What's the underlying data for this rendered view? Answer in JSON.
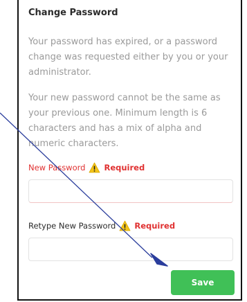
{
  "change_password": {
    "title": "Change Password",
    "paragraph_expired": "Your password has expired, or a password change was requested either by you or your administrator.",
    "paragraph_rules": "Your new password cannot be the same as your previous one. Minimum length is 6 characters and has a mix of alpha and numeric characters.",
    "new_password": {
      "label": "New Password",
      "required_text": "Required",
      "value": "",
      "placeholder": ""
    },
    "retype_password": {
      "label": "Retype New Password",
      "required_text": "Required",
      "value": "",
      "placeholder": ""
    },
    "save_label": "Save"
  },
  "icons": {
    "warning": "warning-triangle-icon"
  },
  "colors": {
    "error_red": "#e03131",
    "save_green": "#40c057",
    "muted_text": "#9a9a9a",
    "warning_yellow": "#f5c518",
    "annotation_arrow": "#2a3d9c"
  }
}
